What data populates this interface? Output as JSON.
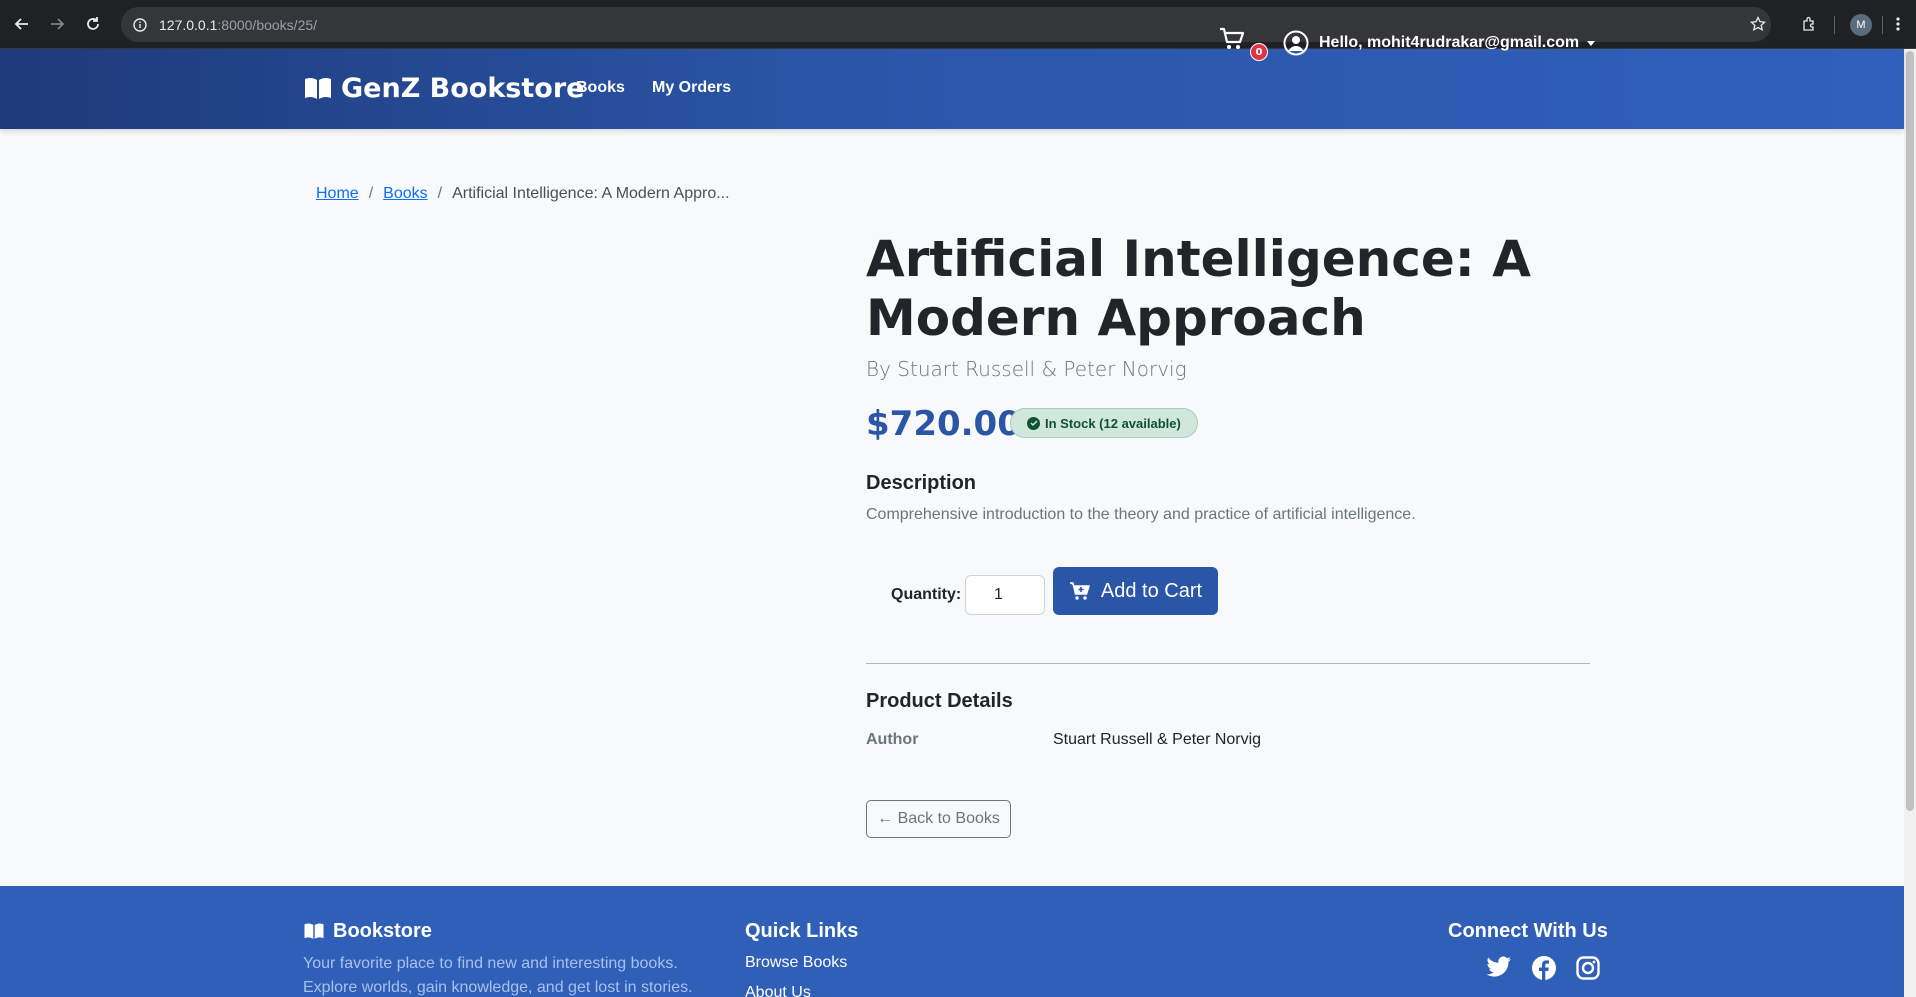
{
  "browser": {
    "url_host": "127.0.0.1",
    "url_path": ":8000/books/25/",
    "profile_initial": "M"
  },
  "navbar": {
    "brand": "GenZ Bookstore",
    "links": [
      "Books",
      "My Orders"
    ],
    "cart_count": "0",
    "user_greeting": "Hello, mohit4rudrakar@gmail.com"
  },
  "breadcrumb": {
    "home": "Home",
    "books": "Books",
    "current": "Artificial Intelligence: A Modern Appro..."
  },
  "product": {
    "title": "Artificial Intelligence: A Modern Approach",
    "author_line": "By Stuart Russell & Peter Norvig",
    "price": "$720.00",
    "stock": "In Stock (12 available)",
    "description_heading": "Description",
    "description": "Comprehensive introduction to the theory and practice of artificial intelligence.",
    "quantity_label": "Quantity:",
    "quantity_value": "1",
    "add_to_cart": "Add to Cart",
    "details_heading": "Product Details",
    "details": [
      {
        "key": "Author",
        "value": "Stuart Russell & Peter Norvig"
      }
    ],
    "back_button": "← Back to Books"
  },
  "footer": {
    "brand": "Bookstore",
    "tagline": "Your favorite place to find new and interesting books. Explore worlds, gain knowledge, and get lost in stories.",
    "quick_links_heading": "Quick Links",
    "quick_links": [
      "Browse Books",
      "About Us"
    ],
    "connect_heading": "Connect With Us",
    "social_icons": [
      "twitter-icon",
      "facebook-icon",
      "instagram-icon"
    ]
  },
  "colors": {
    "primary": "#2b56a8",
    "navbar_dark": "#1e3a7a",
    "success_bg": "#d1e7dd",
    "badge_red": "#dc3545"
  }
}
